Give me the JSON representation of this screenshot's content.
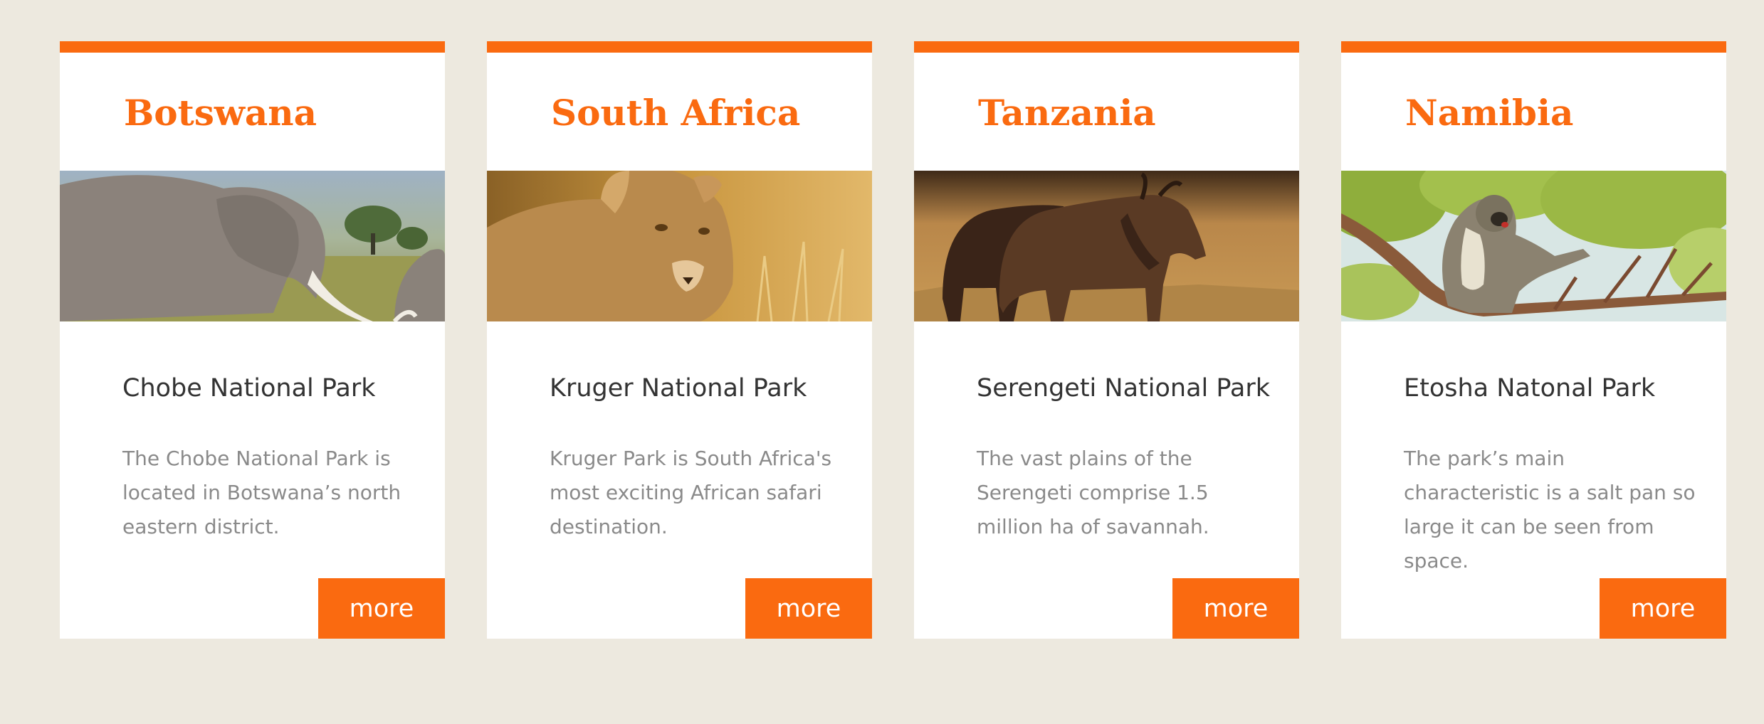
{
  "colors": {
    "background": "#ede9df",
    "accent": "#fa6a10",
    "card": "#ffffff",
    "heading_text": "#333333",
    "body_text": "#8a8a8a"
  },
  "cards": [
    {
      "country": "Botswana",
      "photo": "elephant-photo",
      "park": "Chobe National Park",
      "description": "The Chobe National Park is located in Botswana’s north eastern district.",
      "button": "more"
    },
    {
      "country": "South Africa",
      "photo": "lioness-photo",
      "park": "Kruger National Park",
      "description": "Kruger Park is South Africa's most exciting African safari destination.",
      "button": "more"
    },
    {
      "country": "Tanzania",
      "photo": "wildebeest-photo",
      "park": "Serengeti National Park",
      "description": "The vast plains of the Serengeti comprise 1.5 million ha of savannah.",
      "button": "more"
    },
    {
      "country": "Namibia",
      "photo": "monkey-photo",
      "park": "Etosha Natonal Park",
      "description": "The park’s main characteristic is a salt pan so large it can be seen from space.",
      "button": "more"
    }
  ]
}
